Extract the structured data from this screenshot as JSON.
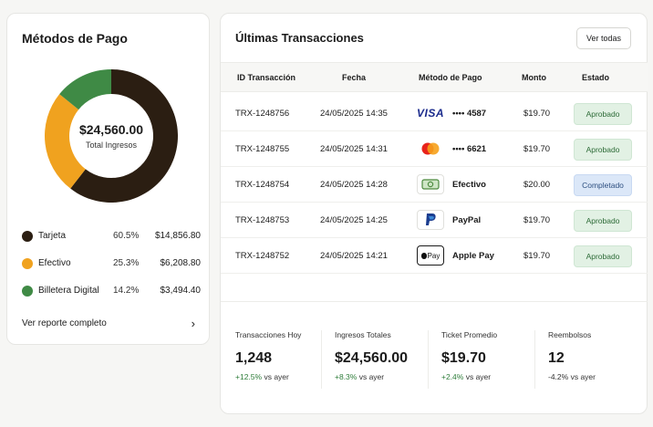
{
  "payment_methods": {
    "title": "Métodos de Pago",
    "total_amount": "$24,560.00",
    "total_label": "Total Ingresos",
    "items": [
      {
        "name": "Tarjeta",
        "percent": "60.5%",
        "amount": "$14,856.80",
        "value": 60.5,
        "color": "#2b1e12"
      },
      {
        "name": "Efectivo",
        "percent": "25.3%",
        "amount": "$6,208.80",
        "value": 25.3,
        "color": "#f0a21f"
      },
      {
        "name": "Billetera Digital",
        "percent": "14.2%",
        "amount": "$3,494.40",
        "value": 14.2,
        "color": "#3f8a45"
      }
    ],
    "report_link": "Ver reporte completo"
  },
  "transactions": {
    "title": "Últimas Transacciones",
    "view_all": "Ver todas",
    "columns": [
      "ID Transacción",
      "Fecha",
      "Método de Pago",
      "Monto",
      "Estado"
    ],
    "rows": [
      {
        "id": "TRX-1248756",
        "date": "24/05/2025 14:35",
        "method": "•••• 4587",
        "icon": "visa-icon",
        "amount": "$19.70",
        "status": "Aprobado",
        "status_type": "ok"
      },
      {
        "id": "TRX-1248755",
        "date": "24/05/2025 14:31",
        "method": "•••• 6621",
        "icon": "mastercard-icon",
        "amount": "$19.70",
        "status": "Aprobado",
        "status_type": "ok"
      },
      {
        "id": "TRX-1248754",
        "date": "24/05/2025 14:28",
        "method": "Efectivo",
        "icon": "cash-icon",
        "amount": "$20.00",
        "status": "Completado",
        "status_type": "done"
      },
      {
        "id": "TRX-1248753",
        "date": "24/05/2025 14:25",
        "method": "PayPal",
        "icon": "paypal-icon",
        "amount": "$19.70",
        "status": "Aprobado",
        "status_type": "ok"
      },
      {
        "id": "TRX-1248752",
        "date": "24/05/2025 14:21",
        "method": "Apple Pay",
        "icon": "apple-pay-icon",
        "amount": "$19.70",
        "status": "Aprobado",
        "status_type": "ok"
      }
    ]
  },
  "kpis": [
    {
      "label": "Transacciones Hoy",
      "value": "1,248",
      "delta": "+12.5%",
      "delta_suffix": "vs ayer",
      "positive": true
    },
    {
      "label": "Ingresos Totales",
      "value": "$24,560.00",
      "delta": "+8.3%",
      "delta_suffix": "vs ayer",
      "positive": true
    },
    {
      "label": "Ticket Promedio",
      "value": "$19.70",
      "delta": "+2.4%",
      "delta_suffix": "vs ayer",
      "positive": true
    },
    {
      "label": "Reembolsos",
      "value": "12",
      "delta": "-4.2%",
      "delta_suffix": "vs ayer",
      "positive": false
    }
  ],
  "icons": {
    "visa_text": "VISA",
    "apple_pay_text": "Pay"
  }
}
